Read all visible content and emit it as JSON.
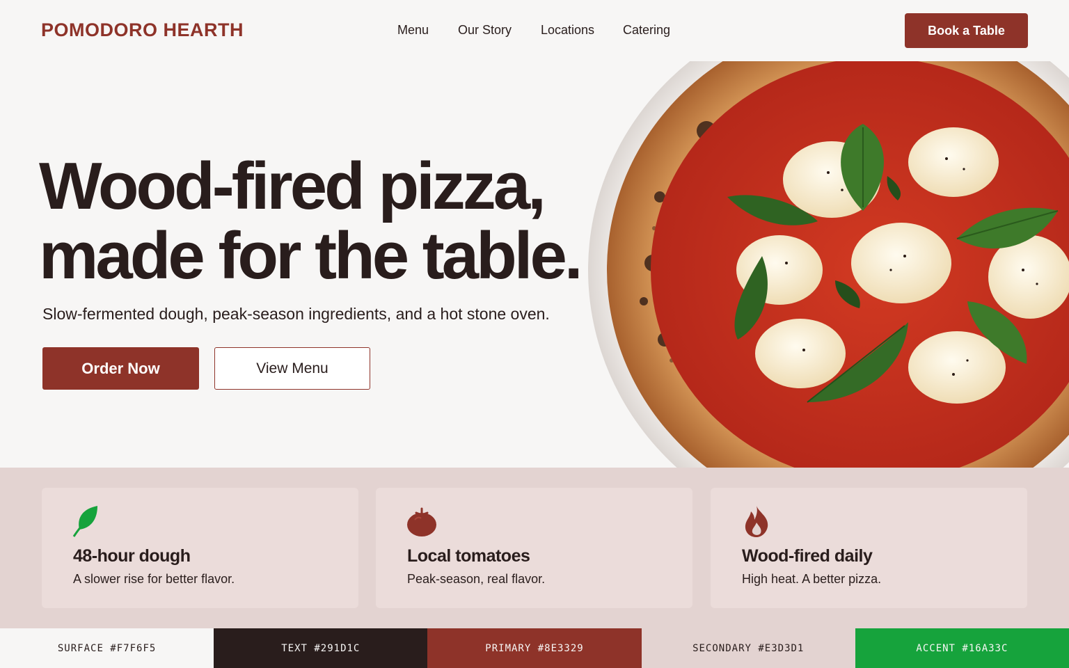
{
  "header": {
    "brand": "POMODORO HEARTH",
    "nav": [
      "Menu",
      "Our Story",
      "Locations",
      "Catering"
    ],
    "cta": "Book a Table"
  },
  "hero": {
    "title_line1": "Wood-fired pizza,",
    "title_line2": "made for the table.",
    "subtitle": "Slow-fermented dough, peak-season ingredients, and a hot stone oven.",
    "primary_button": "Order Now",
    "secondary_button": "View Menu"
  },
  "features": [
    {
      "icon": "leaf-icon",
      "title": "48-hour dough",
      "text": "A slower rise for better flavor."
    },
    {
      "icon": "tomato-icon",
      "title": "Local tomatoes",
      "text": "Peak-season, real flavor."
    },
    {
      "icon": "flame-icon",
      "title": "Wood-fired daily",
      "text": "High heat. A better pizza."
    }
  ],
  "palette": [
    {
      "label": "SURFACE #F7F6F5",
      "color": "#F7F6F5",
      "text_color": "#291D1C"
    },
    {
      "label": "TEXT #291D1C",
      "color": "#291D1C",
      "text_color": "#F7F6F5"
    },
    {
      "label": "PRIMARY #8E3329",
      "color": "#8E3329",
      "text_color": "#F7F6F5"
    },
    {
      "label": "SECONDARY #E3D3D1",
      "color": "#E3D3D1",
      "text_color": "#291D1C"
    },
    {
      "label": "ACCENT #16A33C",
      "color": "#16A33C",
      "text_color": "#F7F6F5"
    }
  ]
}
